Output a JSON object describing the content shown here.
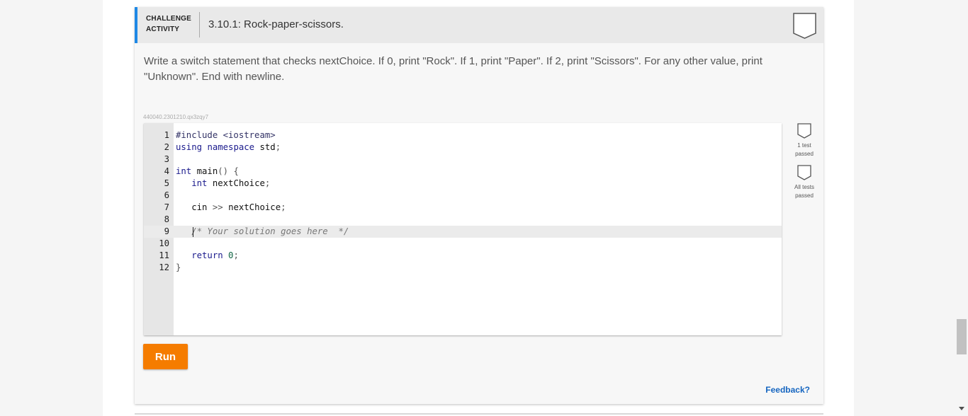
{
  "header": {
    "type_line1": "CHALLENGE",
    "type_line2": "ACTIVITY",
    "title": "3.10.1: Rock-paper-scissors."
  },
  "instructions": "Write a switch statement that checks nextChoice. If 0, print \"Rock\". If 1, print \"Paper\". If 2, print \"Scissors\". For any other value, print \"Unknown\". End with newline.",
  "activity_id": "440040.2301210.qx3zqy7",
  "editor": {
    "line_numbers": [
      "1",
      "2",
      "3",
      "4",
      "5",
      "6",
      "7",
      "8",
      "9",
      "10",
      "11",
      "12"
    ],
    "active_line": 9
  },
  "status": {
    "one_test_line1": "1 test",
    "one_test_line2": "passed",
    "all_tests_line1": "All tests",
    "all_tests_line2": "passed"
  },
  "run_label": "Run",
  "feedback_label": "Feedback?",
  "colors": {
    "accent": "#1e88e5",
    "run_button": "#f57c00",
    "link": "#1565c0"
  }
}
